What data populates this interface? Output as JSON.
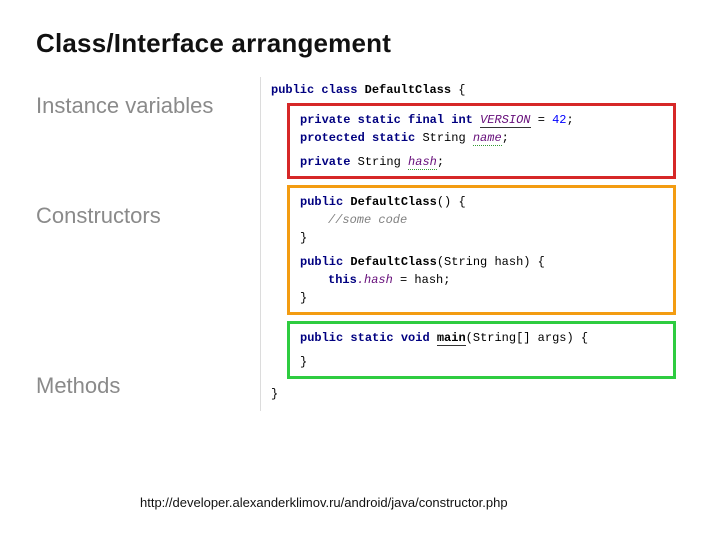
{
  "title": "Class/Interface arrangement",
  "labels": {
    "vars": "Instance variables",
    "constructors": "Constructors",
    "methods": "Methods"
  },
  "kw": {
    "public": "public",
    "class": "class",
    "private": "private",
    "static": "static",
    "final": "final",
    "intkw": "int",
    "protected": "protected",
    "this": "this",
    "void": "void"
  },
  "types": {
    "String": "String",
    "StringArr": "String[]"
  },
  "classHeader": {
    "name": "DefaultClass",
    "brace": " {"
  },
  "vars": {
    "version": {
      "name": "VERSION",
      "eq": " = ",
      "val": "42",
      "semi": ";"
    },
    "nameVar": {
      "name": "name",
      "semi": ";"
    },
    "hash": {
      "name": "hash",
      "semi": ";"
    }
  },
  "ctor": {
    "noarg": {
      "name": "DefaultClass",
      "paren": "() {",
      "comment": "//some code",
      "close": "}"
    },
    "witharg": {
      "name": "DefaultClass",
      "open": "(",
      "arg": " hash",
      "close": ") {",
      "assignLHSField": ".hash",
      "eq": " = hash;",
      "closeBrace": "}"
    }
  },
  "method": {
    "main": {
      "name": "main",
      "open": "(",
      "arg": " args",
      "close": ") {",
      "closeBrace": "}"
    }
  },
  "closing": {
    "brace": "}"
  },
  "footer": "http://developer.alexanderklimov.ru/android/java/constructor.php"
}
